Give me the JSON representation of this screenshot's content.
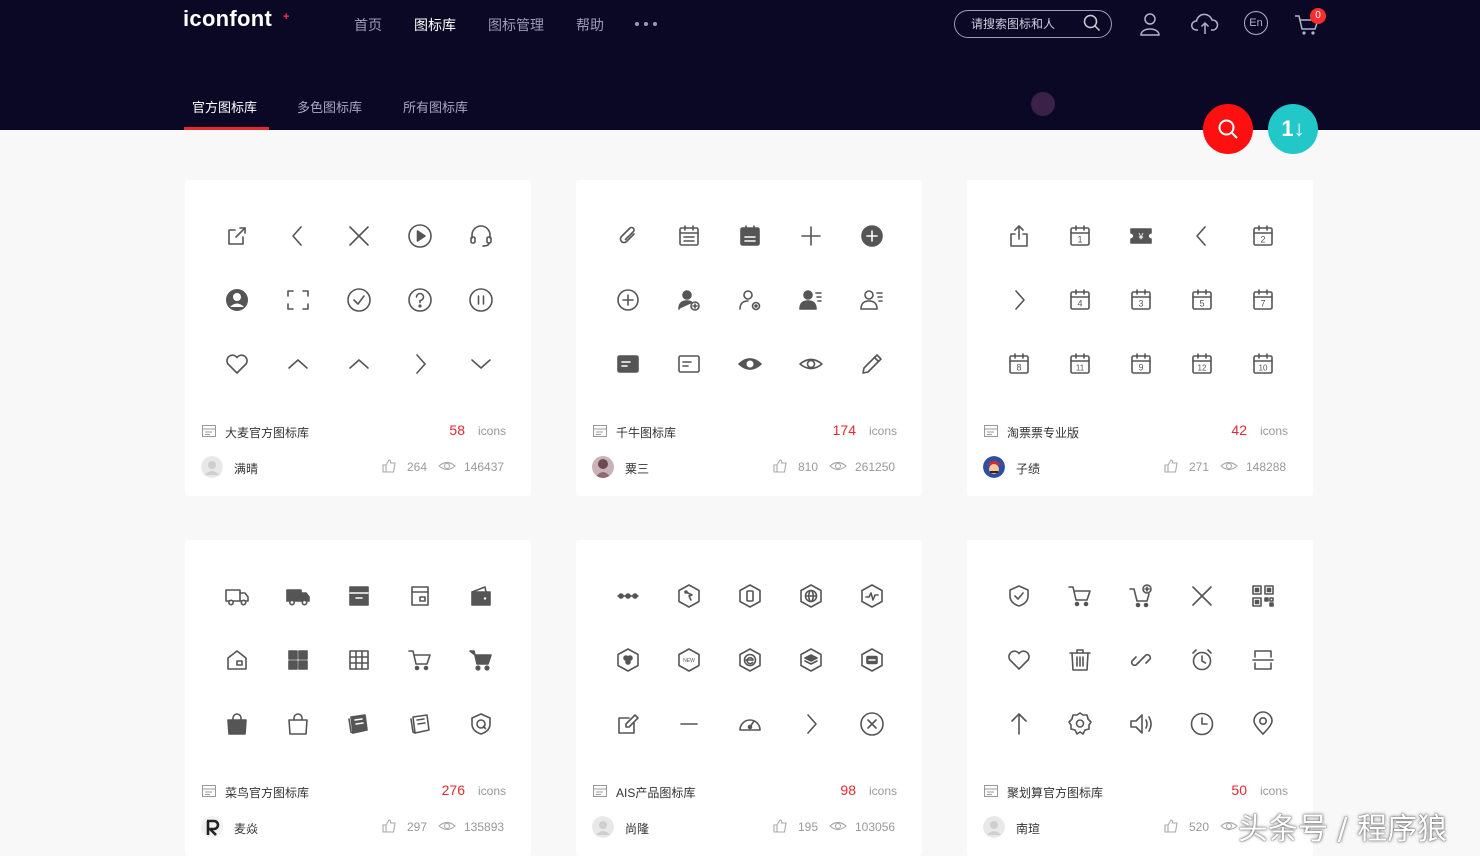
{
  "header": {
    "logo": "iconfont",
    "logo_mark": "+",
    "nav": [
      {
        "label": "首页",
        "active": false
      },
      {
        "label": "图标库",
        "active": true
      },
      {
        "label": "图标管理",
        "active": false
      },
      {
        "label": "帮助",
        "active": false
      }
    ],
    "search_placeholder": "请搜索图标和人",
    "cart_count": "0",
    "lang": "En"
  },
  "subtabs": [
    {
      "label": "官方图标库",
      "active": true
    },
    {
      "label": "多色图标库",
      "active": false
    },
    {
      "label": "所有图标库",
      "active": false
    }
  ],
  "fab": {
    "sort_label": "1↓"
  },
  "unit": "icons",
  "colors": {
    "accent": "#e6282f",
    "header_bg": "#0b0826",
    "fab_search": "#ff1010",
    "fab_sort": "#22c7c9"
  },
  "cards": [
    {
      "name": "大麦官方图标库",
      "count": "58",
      "author": "满晴",
      "likes": "264",
      "views": "146437",
      "avatar": "gray",
      "icons": [
        "share-icon",
        "chevron-left-icon",
        "close-icon",
        "play-circle-icon",
        "headset-icon",
        "user-circle-icon",
        "scan-frame-icon",
        "check-circle-icon",
        "question-circle-icon",
        "pause-circle-icon",
        "heart-icon",
        "chevron-up-icon",
        "chevron-up-icon",
        "chevron-right-icon",
        "chevron-down-icon"
      ]
    },
    {
      "name": "千牛图标库",
      "count": "174",
      "author": "粟三",
      "likes": "810",
      "views": "261250",
      "avatar": "photo",
      "icons": [
        "paperclip-icon",
        "calendar-list-icon",
        "calendar-filled-icon",
        "plus-icon",
        "plus-circle-filled-icon",
        "plus-circle-icon",
        "user-add-icon",
        "user-settings-icon",
        "user-card-filled-icon",
        "user-card-icon",
        "message-filled-icon",
        "message-icon",
        "eye-filled-icon",
        "eye-icon",
        "pencil-icon"
      ]
    },
    {
      "name": "淘票票专业版",
      "count": "42",
      "author": "子绩",
      "likes": "271",
      "views": "148288",
      "avatar": "mario",
      "icons": [
        "upload-box-icon",
        "calendar-1-icon",
        "ticket-yen-icon",
        "chevron-left-icon",
        "calendar-2-icon",
        "chevron-right-icon",
        "calendar-4-icon",
        "calendar-3-icon",
        "calendar-5-icon",
        "calendar-7-icon",
        "calendar-8-icon",
        "calendar-11-icon",
        "calendar-9-icon",
        "calendar-12-icon",
        "calendar-10-icon"
      ],
      "calendar_numbers": {
        "1": "1",
        "4": "2",
        "6": "4",
        "7": "3",
        "8": "5",
        "9": "7",
        "10": "8",
        "11": "11",
        "12": "9",
        "13": "12",
        "14": "10"
      },
      "ticket_symbol": "¥"
    },
    {
      "name": "菜鸟官方图标库",
      "count": "276",
      "author": "麦焱",
      "likes": "297",
      "views": "135893",
      "avatar": "brand",
      "icons": [
        "truck-icon",
        "truck-filled-icon",
        "box-filled-icon",
        "box-icon",
        "wallet-filled-icon",
        "house-box-icon",
        "grid-filled-icon",
        "grid-icon",
        "cart-icon",
        "cart-filled-icon",
        "bag-filled-icon",
        "bag-icon",
        "notebook-icon",
        "notebook-alt-icon",
        "shield-ring-icon"
      ]
    },
    {
      "name": "AIS产品图标库",
      "count": "98",
      "author": "尚隆",
      "likes": "195",
      "views": "103056",
      "avatar": "gray",
      "icons": [
        "dots-line-icon",
        "hex-pointer-icon",
        "hex-device-icon",
        "hex-globe-icon",
        "hex-pulse-icon",
        "hex-nodes-icon",
        "hex-new-icon",
        "hex-edge-icon",
        "hex-layers-icon",
        "hex-card-icon",
        "edit-box-icon",
        "minus-icon",
        "speedometer-icon",
        "chevron-right-icon",
        "close-circle-icon"
      ],
      "new_badge": "NEW"
    },
    {
      "name": "聚划算官方图标库",
      "count": "50",
      "author": "南瑄",
      "likes": "520",
      "views": "",
      "avatar": "gray",
      "icons": [
        "shield-check-icon",
        "cart-icon",
        "cart-add-icon",
        "close-icon",
        "qr-code-icon",
        "heart-icon",
        "trash-icon",
        "link-icon",
        "alarm-icon",
        "split-frame-icon",
        "arrow-up-icon",
        "gear-icon",
        "volume-icon",
        "clock-icon",
        "location-icon"
      ]
    }
  ],
  "watermark": "头条号 / 程序狼"
}
